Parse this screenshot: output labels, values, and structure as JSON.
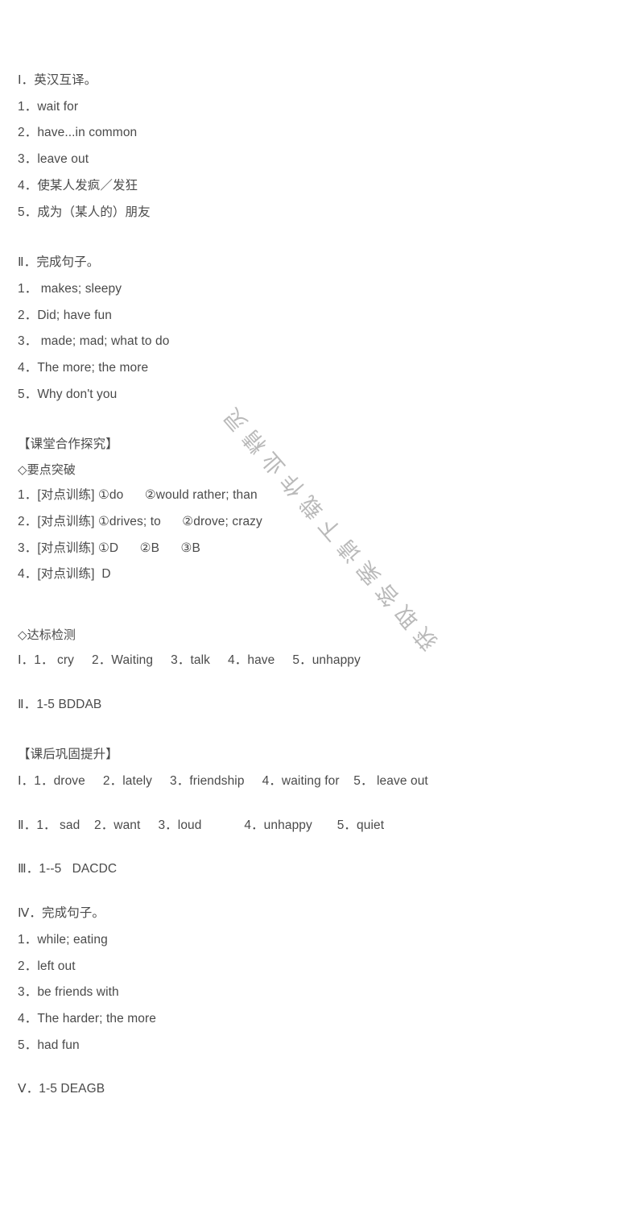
{
  "document": {
    "background_color": "#ffffff",
    "text_color": "#4a4a4a",
    "watermark": {
      "text": "获取答案请下载作业精灵",
      "color": "#b6b6b6",
      "rotation_deg": 229
    }
  },
  "sections": {
    "section1": {
      "heading": "Ⅰ．英汉互译。",
      "items": [
        "1．wait for",
        "2．have...in common",
        "3．leave out",
        "4．使某人发疯／发狂",
        "5．成为（某人的）朋友"
      ]
    },
    "section2": {
      "heading": "Ⅱ．完成句子。",
      "items": [
        "1． makes; sleepy",
        "2．Did; have fun",
        "3． made; mad; what to do",
        "4．The more; the more",
        "5．Why don't you"
      ]
    },
    "section3": {
      "bracket_heading": "【课堂合作探究】",
      "sub_heading": "◇要点突破",
      "items": [
        "1．[对点训练] ①do      ②would rather; than",
        "2．[对点训练] ①drives; to      ②drove; crazy",
        "3．[对点训练] ①D      ②B      ③B",
        "4．[对点训练]  D"
      ]
    },
    "section4": {
      "sub_heading": "◇达标检测",
      "line_1": "Ⅰ．1． cry     2．Waiting     3．talk     4．have     5．unhappy",
      "line_2": "Ⅱ．1-5 BDDAB"
    },
    "section5": {
      "bracket_heading": "【课后巩固提升】",
      "line_1": "Ⅰ．1．drove     2．lately     3．friendship     4．waiting for    5． leave out",
      "line_2": "Ⅱ．1． sad    2．want     3．loud            4．unhappy       5．quiet",
      "line_3": "Ⅲ．1--5   DACDC"
    },
    "section6": {
      "heading": "Ⅳ．完成句子。",
      "items": [
        "1．while; eating",
        "2．left out",
        "3．be friends with",
        "4．The harder; the more",
        "5．had fun"
      ]
    },
    "section7": {
      "line_1": "Ⅴ．1-5 DEAGB"
    }
  }
}
